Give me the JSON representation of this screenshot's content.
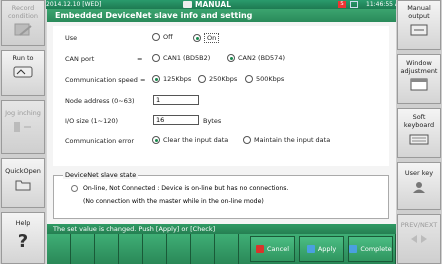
{
  "status_bar": {
    "date": "2014.12.10 [WED]",
    "mode": "MANUAL",
    "alarm": "S",
    "time": "11:46:55 AM"
  },
  "left_menu": {
    "record_condition": "Record condition",
    "run_to": "Run to",
    "jog_inching": "Jog inching",
    "quickopen": "QuickOpen",
    "help": "Help"
  },
  "right_menu": {
    "manual_output": "Manual output",
    "window_adjustment": "Window adjustment",
    "soft_keyboard": "Soft keyboard",
    "user_key": "User key",
    "prev_next": "PREV/NEXT"
  },
  "page": {
    "title": "Embedded DeviceNet slave info and setting"
  },
  "form": {
    "use_label": "Use",
    "use_off": "Off",
    "use_on": "On",
    "can_port_label": "CAN port",
    "eq": "=",
    "can1": "CAN1 (BD5B2)",
    "can2": "CAN2 (BD574)",
    "speed_label": "Communication speed =",
    "speed_125": "125Kbps",
    "speed_250": "250Kbps",
    "speed_500": "500Kbps",
    "node_label": "Node address (0~63)",
    "node_value": "1",
    "io_label": "I/O size (1~120)",
    "io_value": "16",
    "io_unit": "Bytes",
    "comm_error_label": "Communication error",
    "comm_clear": "Clear the input data",
    "comm_maintain": "Maintain the input data"
  },
  "slave_state": {
    "title": "DeviceNet slave state",
    "line1": "On-line, Not Connected : Device is on-line but has no connections.",
    "line2": "(No connection with the master while in the on-line mode)"
  },
  "message": "The set value is changed. Push [Apply] or [Check]",
  "buttons": {
    "cancel": "Cancel",
    "apply": "Apply",
    "complete": "Complete"
  },
  "colors": {
    "accent": "#2a8a5a",
    "cancel_icon": "#d9342b",
    "apply_icon": "#4aa0e0",
    "complete_icon": "#4aa0e0"
  }
}
